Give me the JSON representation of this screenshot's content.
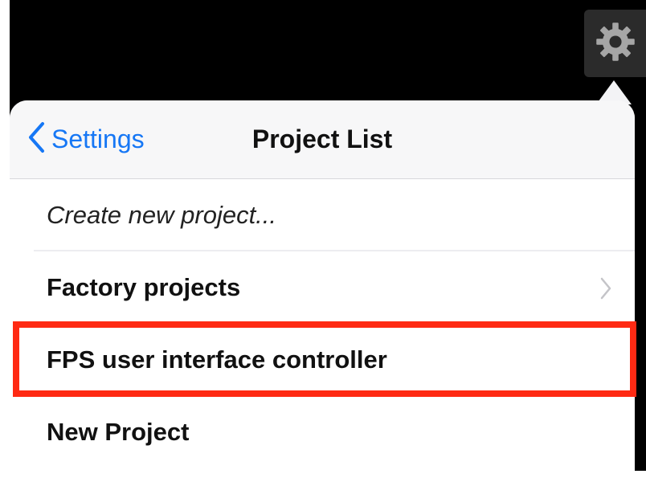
{
  "toolbar": {
    "settings_icon": "gear-icon"
  },
  "navbar": {
    "back_label": "Settings",
    "title": "Project List"
  },
  "list": {
    "create_label": "Create new project...",
    "items": [
      {
        "label": "Factory projects",
        "has_chevron": true
      },
      {
        "label": "FPS user interface controller",
        "has_chevron": false
      },
      {
        "label": "New Project",
        "has_chevron": false
      }
    ]
  },
  "colors": {
    "accent": "#1677f5",
    "highlight": "#ff2a13"
  }
}
